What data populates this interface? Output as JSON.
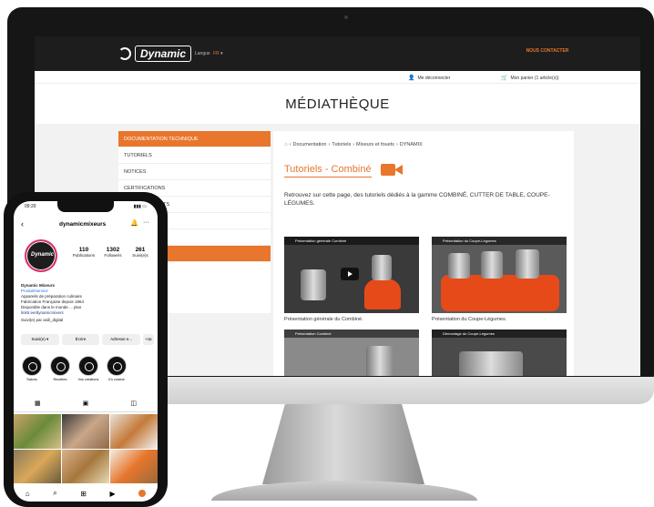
{
  "site": {
    "logo": "Dynamic",
    "lang_label": "Langue",
    "lang_code": "FR",
    "contact": "NOUS CONTACTER",
    "logout": "Me déconnecter",
    "cart": "Mon panier (1 article(s))",
    "page_title": "MÉDIATHÈQUE"
  },
  "sidebar": {
    "items": [
      {
        "label": "DOCUMENTATION TECHNIQUE"
      },
      {
        "label": "TUTORIELS"
      },
      {
        "label": "NOTICES"
      },
      {
        "label": "CERTIFICATIONS"
      },
      {
        "label": "FICHES PRODUITS"
      },
      {
        "label": ""
      },
      {
        "label": ""
      },
      {
        "label": "VIDÉOS"
      }
    ]
  },
  "content": {
    "breadcrumb": [
      "Documentation",
      "Tutoriels",
      "Mixeurs et fouets",
      "DYNAMIX"
    ],
    "title": "Tutoriels - Combiné",
    "intro": "Retrouvez sur cette page, des tutoriels dédiés à la gamme COMBINÉ, CUTTER DE TABLE, COUPE-LÉGUMES.",
    "videos": [
      {
        "bar": "Présentation générale Combiné",
        "caption": "Présentation générale du Combiné."
      },
      {
        "bar": "Présentation du Coupe-Légumes",
        "caption": "Présentation du Coupe-Légumes."
      },
      {
        "bar": "Présentation Combiné",
        "caption": ""
      },
      {
        "bar": "Démontage du Coupe-Légumes",
        "caption": ""
      }
    ]
  },
  "phone": {
    "time": "09:20",
    "username": "dynamicmixeurs",
    "avatar_text": "Dynamic",
    "stats": [
      {
        "num": "110",
        "label": "Publications"
      },
      {
        "num": "1302",
        "label": "Followers"
      },
      {
        "num": "261",
        "label": "Suivi(e)s"
      }
    ],
    "bio": {
      "name": "Dynamic Mixeurs",
      "category": "Produit/service",
      "line1": "Appareils de préparation culinaire",
      "line2": "Fabrication Française depuis 1964",
      "line3": "Disponible dans le monde ... plus",
      "link": "linktr.ee/dynamicmixers",
      "followed": "Suivi(e) par asili_digital"
    },
    "buttons": [
      "Suivi(e) ▾",
      "Écrire",
      "Adresse e...",
      "+ꝏ"
    ],
    "highlights": [
      "Salons",
      "Recettes",
      "Vos créations",
      "En cuisine"
    ]
  }
}
